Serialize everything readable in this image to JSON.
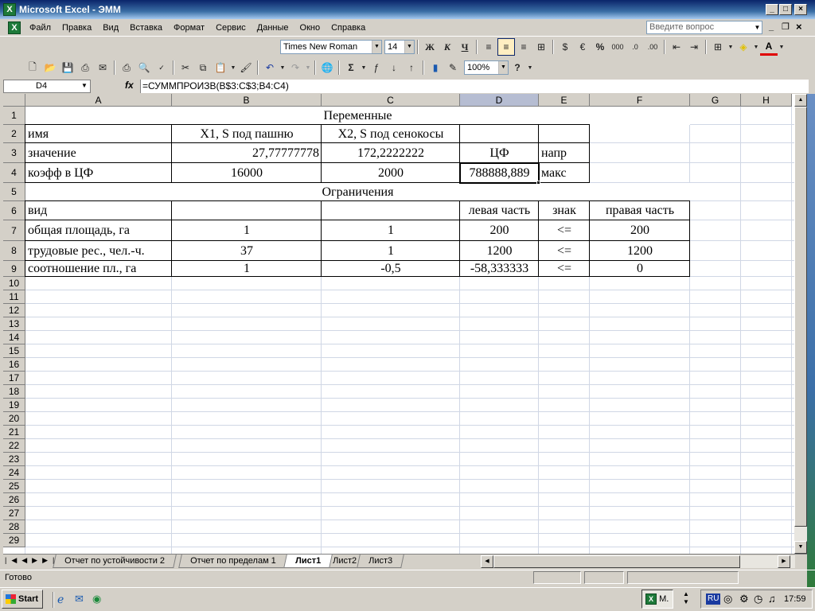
{
  "window": {
    "title": "Microsoft Excel - ЭММ"
  },
  "menu": [
    "Файл",
    "Правка",
    "Вид",
    "Вставка",
    "Формат",
    "Сервис",
    "Данные",
    "Окно",
    "Справка"
  ],
  "ask_placeholder": "Введите вопрос",
  "toolbar": {
    "font": "Times New Roman",
    "size": "14",
    "zoom": "100%",
    "bold": "Ж",
    "italic": "К",
    "underline": "Ч",
    "euro": "€",
    "percent": "%",
    "thousands": "000"
  },
  "formula_bar": {
    "name_box": "D4",
    "fx": "fx",
    "formula": "=СУММПРОИЗВ(B$3:C$3;B4:C4)"
  },
  "columns": [
    "A",
    "B",
    "C",
    "D",
    "E",
    "F",
    "G",
    "H"
  ],
  "rows": [
    "1",
    "2",
    "3",
    "4",
    "5",
    "6",
    "7",
    "8",
    "9",
    "10",
    "11",
    "12",
    "13",
    "14",
    "15",
    "16",
    "17",
    "18",
    "19",
    "20",
    "21",
    "22",
    "23",
    "24",
    "25",
    "26",
    "27",
    "28",
    "29"
  ],
  "cells": {
    "B1": "Переменные",
    "A2": "имя",
    "B2": "X1, S под пашню",
    "C2": "X2, S под сенокосы",
    "A3": "значение",
    "B3": "27,77777778",
    "C3": "172,2222222",
    "D3": "ЦФ",
    "E3": "напр",
    "A4": "коэфф в ЦФ",
    "B4": "16000",
    "C4": "2000",
    "D4": "788888,889",
    "E4": "макс",
    "B5": "Ограничения",
    "A6": "вид",
    "D6": "левая часть",
    "E6": "знак",
    "F6": "правая часть",
    "A7": "общая площадь, га",
    "B7": "1",
    "C7": "1",
    "D7": "200",
    "E7": "<=",
    "F7": "200",
    "A8": "трудовые рес., чел.-ч.",
    "B8": "37",
    "C8": "1",
    "D8": "1200",
    "E8": "<=",
    "F8": "1200",
    "A9": "соотношение пл., га",
    "B9": "1",
    "C9": "-0,5",
    "D9": "-58,333333",
    "E9": "<=",
    "F9": "0"
  },
  "sheets": [
    "Отчет по устойчивости 2",
    "Отчет по пределам 1",
    "Лист1",
    "Лист2",
    "Лист3"
  ],
  "active_sheet": "Лист1",
  "status": "Готово",
  "taskbar": {
    "start": "Start",
    "task": "M.",
    "lang": "RU",
    "clock": "17:59"
  }
}
